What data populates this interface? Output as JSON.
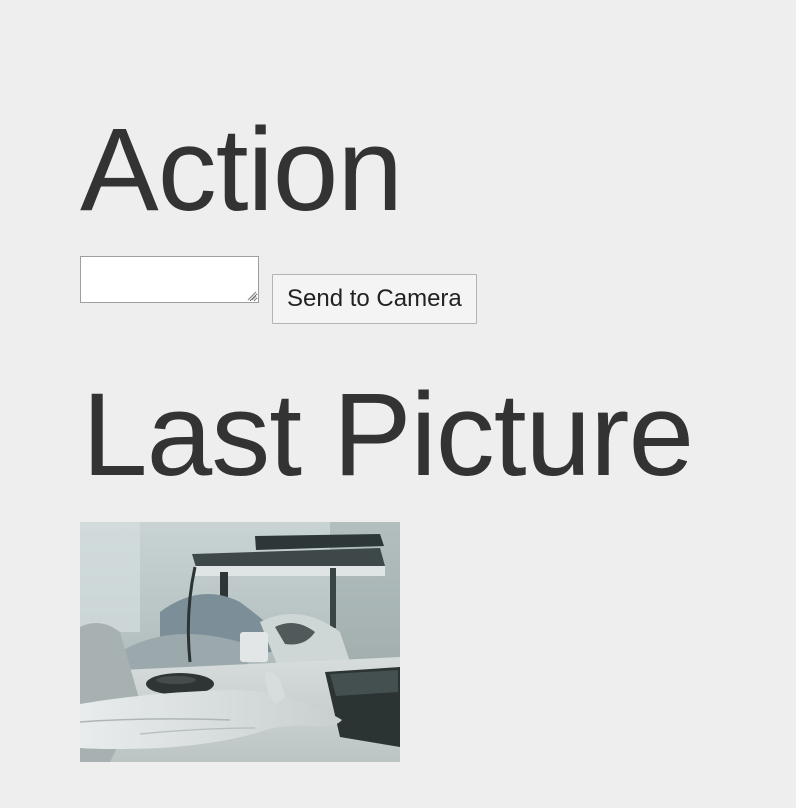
{
  "action": {
    "heading": "Action",
    "input_value": "",
    "input_placeholder": "",
    "send_button_label": "Send to Camera"
  },
  "last_picture": {
    "heading": "Last Picture",
    "image_subject": "grayscale webcam photo of a desk with monitor, keyboard, mouse and a hand"
  },
  "colors": {
    "background": "#eeeeee",
    "text": "#333333",
    "button_background": "#f4f4f4",
    "button_border": "#b3b3b3",
    "input_border": "#9e9e9e"
  }
}
